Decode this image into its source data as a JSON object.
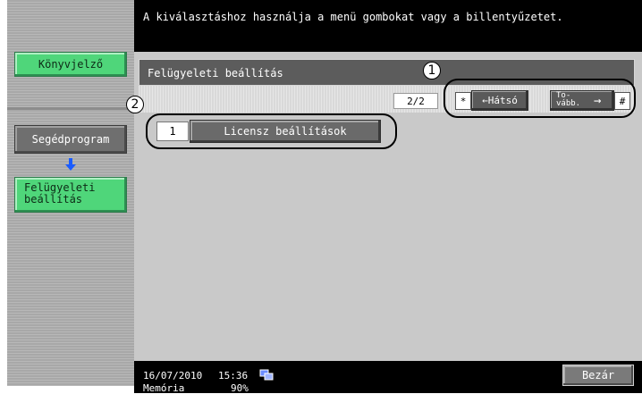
{
  "instruction": "A kiválasztáshoz használja a menü gombokat vagy a billentyűzetet.",
  "sidebar": {
    "bookmark_label": "Könyvjelző",
    "utility_label": "Segédprogram",
    "admin_label_line1": "Felügyeleti",
    "admin_label_line2": "beállítás",
    "arrow_icon": "arrow-down-icon"
  },
  "header": {
    "title": "Felügyeleti beállítás"
  },
  "pager": {
    "page_indicator": "2/2",
    "back_key": "*",
    "back_label": "←Hátsó",
    "forward_label_line1": "To-",
    "forward_label_line2": "vább.",
    "forward_arrow": "→",
    "forward_key": "#"
  },
  "items": [
    {
      "number": "1",
      "label": "Licensz beállítások"
    }
  ],
  "callouts": {
    "one": "1",
    "two": "2"
  },
  "status": {
    "date": "16/07/2010",
    "time": "15:36",
    "memory_label": "Memória",
    "memory_value": "90%"
  },
  "close_label": "Bezár",
  "colors": {
    "green": "#4fd67a",
    "dark": "#000000",
    "panel": "#c9c9c9"
  }
}
